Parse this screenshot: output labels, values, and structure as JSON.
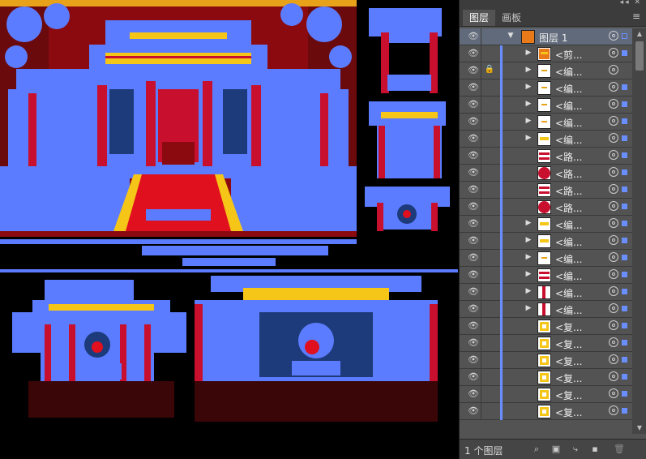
{
  "panel": {
    "collapse_icon": "double-chevron-left-icon",
    "tabs": [
      {
        "label": "图层",
        "active": true
      },
      {
        "label": "画板",
        "active": false
      }
    ],
    "menu_icon": "panel-menu-icon",
    "top_layer": {
      "name": "图层 1"
    },
    "layers": [
      {
        "name": "<剪...",
        "expandable": true,
        "locked": false,
        "thumb": "orange"
      },
      {
        "name": "<编...",
        "expandable": true,
        "locked": true,
        "thumb": "dash"
      },
      {
        "name": "<编...",
        "expandable": true,
        "locked": false,
        "thumb": "dash"
      },
      {
        "name": "<编...",
        "expandable": true,
        "locked": false,
        "thumb": "dash"
      },
      {
        "name": "<编...",
        "expandable": true,
        "locked": false,
        "thumb": "dash"
      },
      {
        "name": "<编...",
        "expandable": true,
        "locked": false,
        "thumb": "yellow"
      },
      {
        "name": "<路...",
        "expandable": false,
        "locked": false,
        "thumb": "redbar"
      },
      {
        "name": "<路...",
        "expandable": false,
        "locked": false,
        "thumb": "redcircle"
      },
      {
        "name": "<路...",
        "expandable": false,
        "locked": false,
        "thumb": "redbar"
      },
      {
        "name": "<路...",
        "expandable": false,
        "locked": false,
        "thumb": "redcircle"
      },
      {
        "name": "<编...",
        "expandable": true,
        "locked": false,
        "thumb": "yellow"
      },
      {
        "name": "<编...",
        "expandable": true,
        "locked": false,
        "thumb": "yellow"
      },
      {
        "name": "<编...",
        "expandable": true,
        "locked": false,
        "thumb": "dash"
      },
      {
        "name": "<编...",
        "expandable": true,
        "locked": false,
        "thumb": "redbar"
      },
      {
        "name": "<编...",
        "expandable": true,
        "locked": false,
        "thumb": "redpillar"
      },
      {
        "name": "<编...",
        "expandable": true,
        "locked": false,
        "thumb": "redpillar"
      },
      {
        "name": "<复...",
        "expandable": false,
        "locked": false,
        "thumb": "gold"
      },
      {
        "name": "<复...",
        "expandable": false,
        "locked": false,
        "thumb": "gold"
      },
      {
        "name": "<复...",
        "expandable": false,
        "locked": false,
        "thumb": "gold"
      },
      {
        "name": "<复...",
        "expandable": false,
        "locked": false,
        "thumb": "gold"
      },
      {
        "name": "<复...",
        "expandable": false,
        "locked": false,
        "thumb": "gold"
      },
      {
        "name": "<复...",
        "expandable": false,
        "locked": false,
        "thumb": "gold"
      }
    ],
    "status": {
      "count_label": "1 个图层",
      "icons": [
        "search-icon",
        "make-clip-icon",
        "new-sublayer-icon",
        "new-layer-icon",
        "delete-icon"
      ]
    }
  },
  "colors": {
    "selection_blue": "#5b7cff",
    "accent_blue": "#6a8eff",
    "red": "#c8102e",
    "gold": "#f5c518"
  }
}
